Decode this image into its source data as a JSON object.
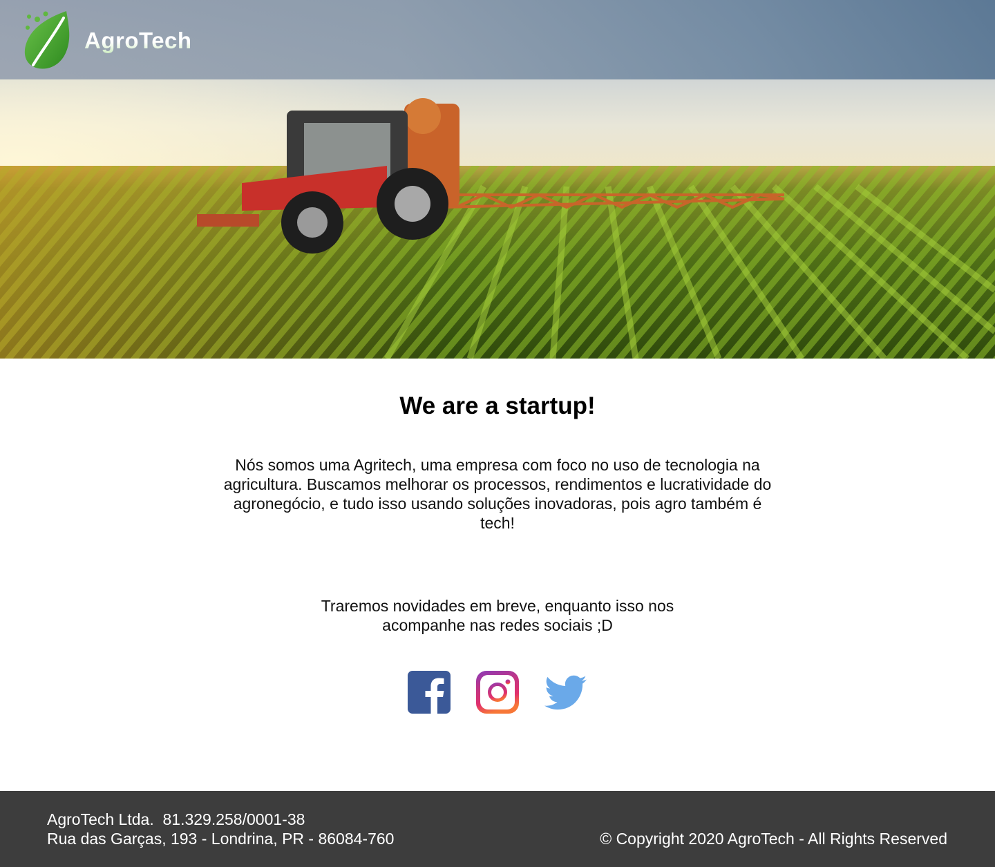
{
  "header": {
    "brand": "AgroTech",
    "logo_icon": "leaf-icon",
    "hero_image": "tractor-spraying-crop-field"
  },
  "main": {
    "headline": "We are a startup!",
    "intro": "Nós somos uma Agritech, uma empresa com foco no uso de tecnologia na agricultura. Buscamos melhorar os processos, rendimentos e lucratividade do agronegócio, e tudo isso usando soluções inovadoras, pois agro também é tech!",
    "teaser": "Traremos novidades em breve, enquanto isso nos acompanhe nas redes sociais ;D",
    "social": [
      {
        "icon": "facebook-icon",
        "color": "#3b5998"
      },
      {
        "icon": "instagram-icon",
        "color": "#c13584"
      },
      {
        "icon": "twitter-icon",
        "color": "#6aa9e9"
      }
    ]
  },
  "footer": {
    "company_line": "AgroTech Ltda.  81.329.258/0001-38",
    "address_line": "Rua das Garças, 193 - Londrina, PR - 86084-760",
    "copyright": "© Copyright 2020 AgroTech - All Rights Reserved"
  },
  "colors": {
    "footer_bg": "#3d3d3d",
    "brand_green": "#3f9e2c"
  }
}
